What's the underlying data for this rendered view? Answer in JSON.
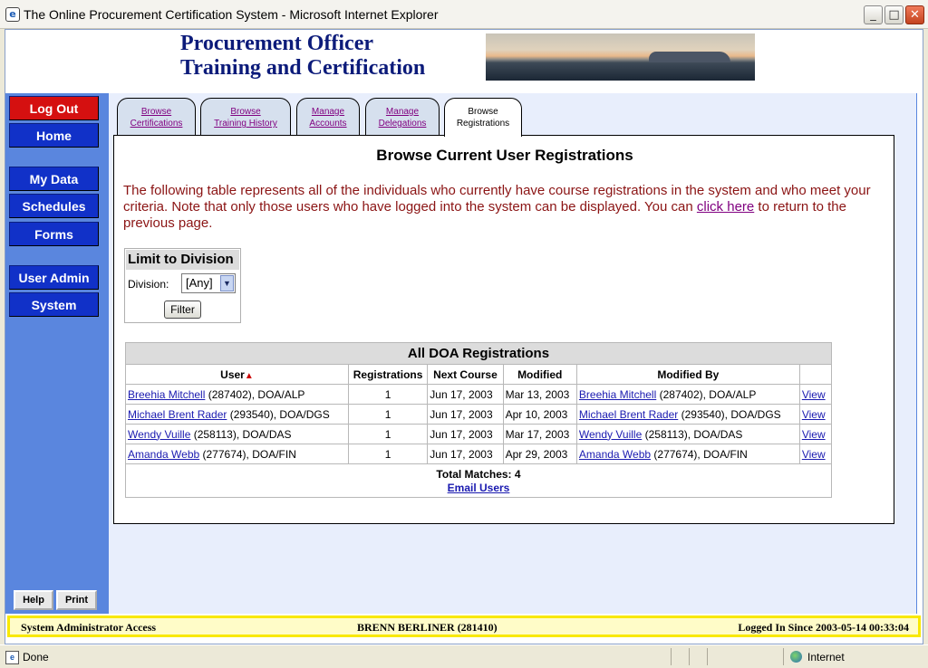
{
  "window": {
    "title": "The Online Procurement Certification System - Microsoft Internet Explorer"
  },
  "banner": {
    "line1": "Procurement Officer",
    "line2": "Training and Certification"
  },
  "sidebar": {
    "items": [
      {
        "label": "Log Out"
      },
      {
        "label": "Home"
      },
      {
        "label": "My Data"
      },
      {
        "label": "Schedules"
      },
      {
        "label": "Forms"
      },
      {
        "label": "User Admin"
      },
      {
        "label": "System"
      }
    ],
    "help_label": "Help",
    "print_label": "Print"
  },
  "tabs": [
    {
      "line1": "Browse",
      "line2": "Certifications"
    },
    {
      "line1": "Browse",
      "line2": "Training History"
    },
    {
      "line1": "Manage",
      "line2": "Accounts"
    },
    {
      "line1": "Manage",
      "line2": "Delegations"
    },
    {
      "line1": "Browse",
      "line2": "Registrations"
    }
  ],
  "page": {
    "title": "Browse Current User Registrations",
    "intro_before": "The following table represents all of the individuals who currently have course registrations in the system and who meet your criteria. Note that only those users who have logged into the system can be displayed. You can ",
    "intro_link": "click here",
    "intro_after": " to return to the previous page."
  },
  "filter": {
    "heading": "Limit to Division",
    "label": "Division:",
    "selected": "[Any]",
    "button": "Filter"
  },
  "table": {
    "caption": "All DOA Registrations",
    "headers": [
      "User",
      "Registrations",
      "Next Course",
      "Modified",
      "Modified By"
    ],
    "rows": [
      {
        "user_link": "Breehia Mitchell",
        "user_rest": " (287402), DOA/ALP",
        "registrations": "1",
        "next_course": "Jun 17, 2003",
        "modified": "Mar 13, 2003",
        "modby_link": "Breehia Mitchell",
        "modby_rest": " (287402), DOA/ALP",
        "action": "View"
      },
      {
        "user_link": "Michael Brent Rader",
        "user_rest": " (293540), DOA/DGS",
        "registrations": "1",
        "next_course": "Jun 17, 2003",
        "modified": "Apr 10, 2003",
        "modby_link": "Michael Brent Rader",
        "modby_rest": " (293540), DOA/DGS",
        "action": "View"
      },
      {
        "user_link": "Wendy Vuille",
        "user_rest": " (258113), DOA/DAS",
        "registrations": "1",
        "next_course": "Jun 17, 2003",
        "modified": "Mar 17, 2003",
        "modby_link": "Wendy Vuille",
        "modby_rest": " (258113), DOA/DAS",
        "action": "View"
      },
      {
        "user_link": "Amanda Webb",
        "user_rest": " (277674), DOA/FIN",
        "registrations": "1",
        "next_course": "Jun 17, 2003",
        "modified": "Apr 29, 2003",
        "modby_link": "Amanda Webb",
        "modby_rest": " (277674), DOA/FIN",
        "action": "View"
      }
    ],
    "total": "Total Matches: 4",
    "email_link": "Email Users"
  },
  "statusline": {
    "left": "System Administrator Access",
    "middle": "BRENN BERLINER (281410)",
    "right": "Logged In Since 2003-05-14 00:33:04"
  },
  "iestatus": {
    "done": "Done",
    "zone": "Internet"
  }
}
